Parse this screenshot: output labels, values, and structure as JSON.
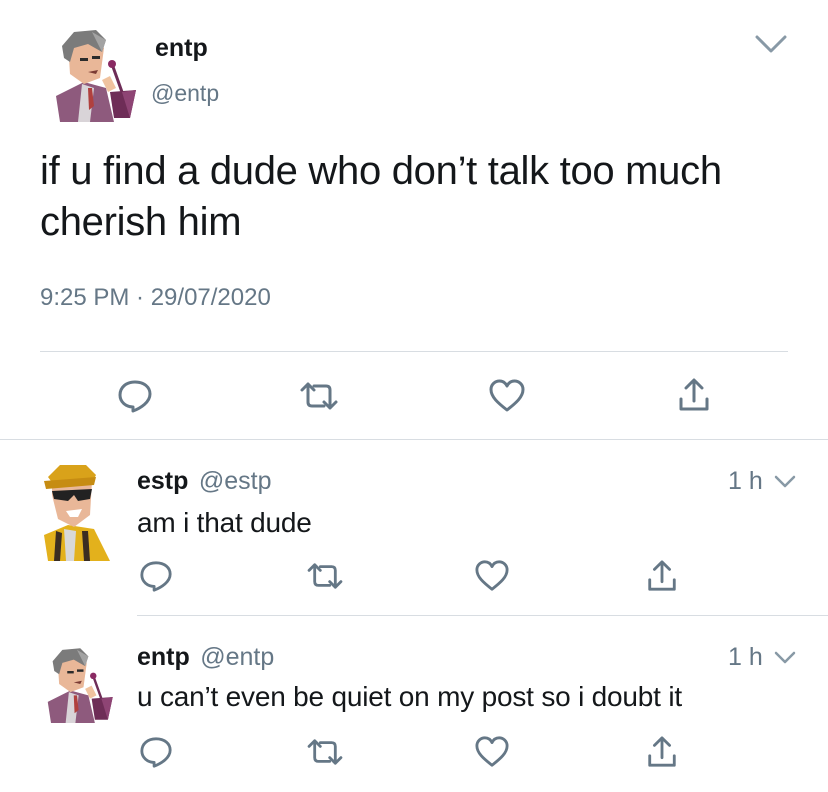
{
  "main_tweet": {
    "display_name": "entp",
    "handle": "@entp",
    "text_line1": "if u find a dude who don’t talk too much",
    "text_line2": "cherish him",
    "timestamp": "9:25 PM · 29/07/2020",
    "avatar_icon": "businessman-avatar-icon",
    "menu_icon": "chevron-down-icon"
  },
  "replies": [
    {
      "display_name": "estp",
      "handle": "@estp",
      "time": "1 h",
      "text": "am i that dude",
      "avatar_icon": "sunglasses-worker-avatar-icon"
    },
    {
      "display_name": "entp",
      "handle": "@entp",
      "time": "1 h",
      "text": "u can’t even be quiet on my post so i doubt it",
      "avatar_icon": "businessman-avatar-icon"
    }
  ],
  "actions": [
    "reply-icon",
    "retweet-icon",
    "like-icon",
    "share-icon"
  ],
  "colors": {
    "text": "#14171a",
    "muted": "#657786",
    "icon": "#657786",
    "divider": "#d8dde2"
  }
}
